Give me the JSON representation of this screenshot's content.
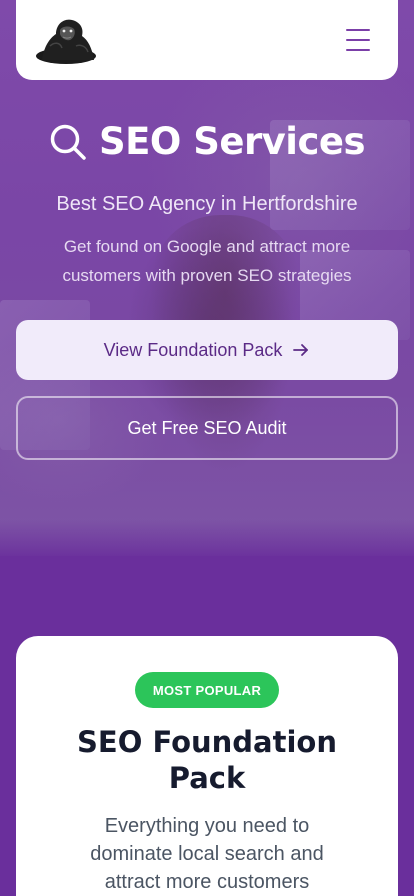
{
  "header": {
    "logo_alt": "gorilla logo",
    "menu_icon": "hamburger-menu-icon"
  },
  "hero": {
    "title_icon": "search-icon",
    "title": "SEO Services",
    "subtitle": "Best SEO Agency in Hertfordshire",
    "description": "Get found on Google and attract more customers with proven SEO strategies",
    "primary_button": "View Foundation Pack",
    "primary_button_icon": "arrow-right-icon",
    "secondary_button": "Get Free SEO Audit"
  },
  "card": {
    "badge": "MOST POPULAR",
    "title": "SEO Foundation Pack",
    "description": "Everything you need to dominate local search and attract more customers"
  },
  "colors": {
    "brand_purple": "#6a2f9c",
    "badge_green": "#2cc55a",
    "button_light": "#f1ebfa",
    "title_dark": "#161b2e"
  }
}
